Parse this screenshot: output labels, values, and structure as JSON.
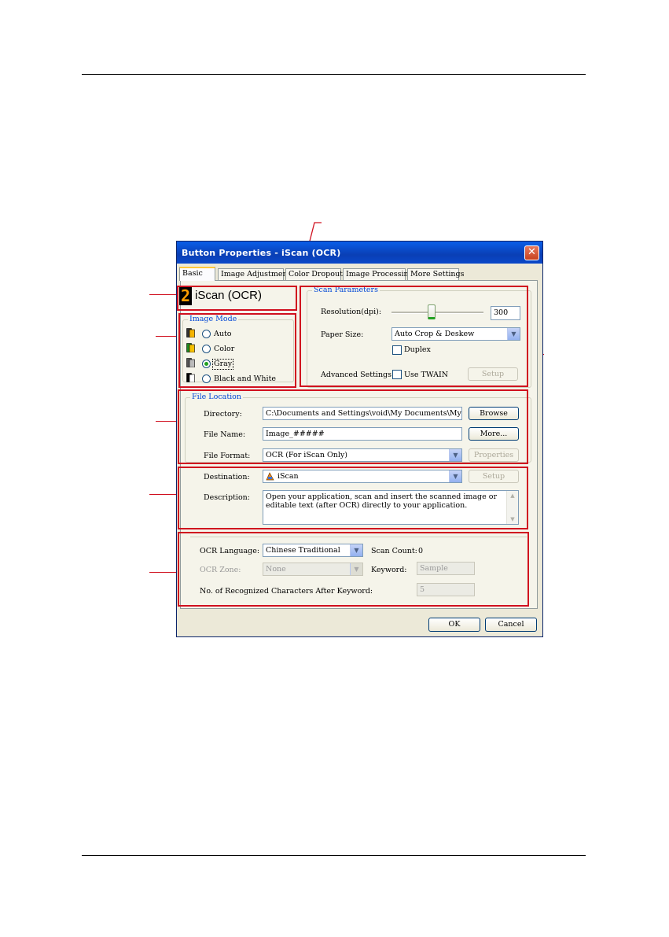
{
  "dialog": {
    "title": "Button Properties - iScan (OCR)",
    "close_symbol": "✕",
    "tabs": [
      {
        "label": "Basic",
        "active": true
      },
      {
        "label": "Image Adjustment",
        "active": false
      },
      {
        "label": "Color Dropout",
        "active": false
      },
      {
        "label": "Image Processing",
        "active": false
      },
      {
        "label": "More Settings",
        "active": false
      }
    ],
    "button_number": "2",
    "button_name": "iScan (OCR)",
    "image_mode": {
      "title": "Image Mode",
      "options": [
        {
          "label": "Auto",
          "selected": false,
          "icon": "auto-mode-icon"
        },
        {
          "label": "Color",
          "selected": false,
          "icon": "color-mode-icon"
        },
        {
          "label": "Gray",
          "selected": true,
          "icon": "gray-mode-icon"
        },
        {
          "label": "Black and White",
          "selected": false,
          "icon": "bw-mode-icon"
        }
      ]
    },
    "scan_parameters": {
      "title": "Scan Parameters",
      "resolution_label": "Resolution(dpi):",
      "resolution_value": "300",
      "resolution_slider_fraction": 0.44,
      "paper_size_label": "Paper Size:",
      "paper_size_value": "Auto Crop & Deskew",
      "duplex_label": "Duplex",
      "duplex_checked": false,
      "advanced_label": "Advanced Settings:",
      "twain_label": "Use TWAIN",
      "twain_checked": false,
      "setup_label": "Setup"
    },
    "file_location": {
      "title": "File Location",
      "directory_label": "Directory:",
      "directory_value": "C:\\Documents and Settings\\void\\My Documents\\My Pictures",
      "browse_label": "Browse",
      "file_name_label": "File Name:",
      "file_name_value": "Image_#####",
      "more_label": "More...",
      "file_format_label": "File Format:",
      "file_format_value": "OCR (For iScan Only)",
      "properties_label": "Properties"
    },
    "destination": {
      "label": "Destination:",
      "value": "iScan",
      "setup_label": "Setup",
      "description_label": "Description:",
      "description_text": "Open your application, scan and insert the scanned image or editable text (after OCR) directly to your application."
    },
    "ocr": {
      "language_label": "OCR Language:",
      "language_value": "Chinese Traditional",
      "scan_count_label": "Scan Count:",
      "scan_count_value": "0",
      "zone_label": "OCR Zone:",
      "zone_value": "None",
      "keyword_label": "Keyword:",
      "keyword_value": "Sample",
      "recognized_label": "No. of Recognized Characters After Keyword:",
      "recognized_value": "5"
    },
    "ok_label": "OK",
    "cancel_label": "Cancel"
  },
  "colors": {
    "callout_red": "#d0101f",
    "title_blue": "#0a48c9",
    "group_title_blue": "#0046d5"
  }
}
